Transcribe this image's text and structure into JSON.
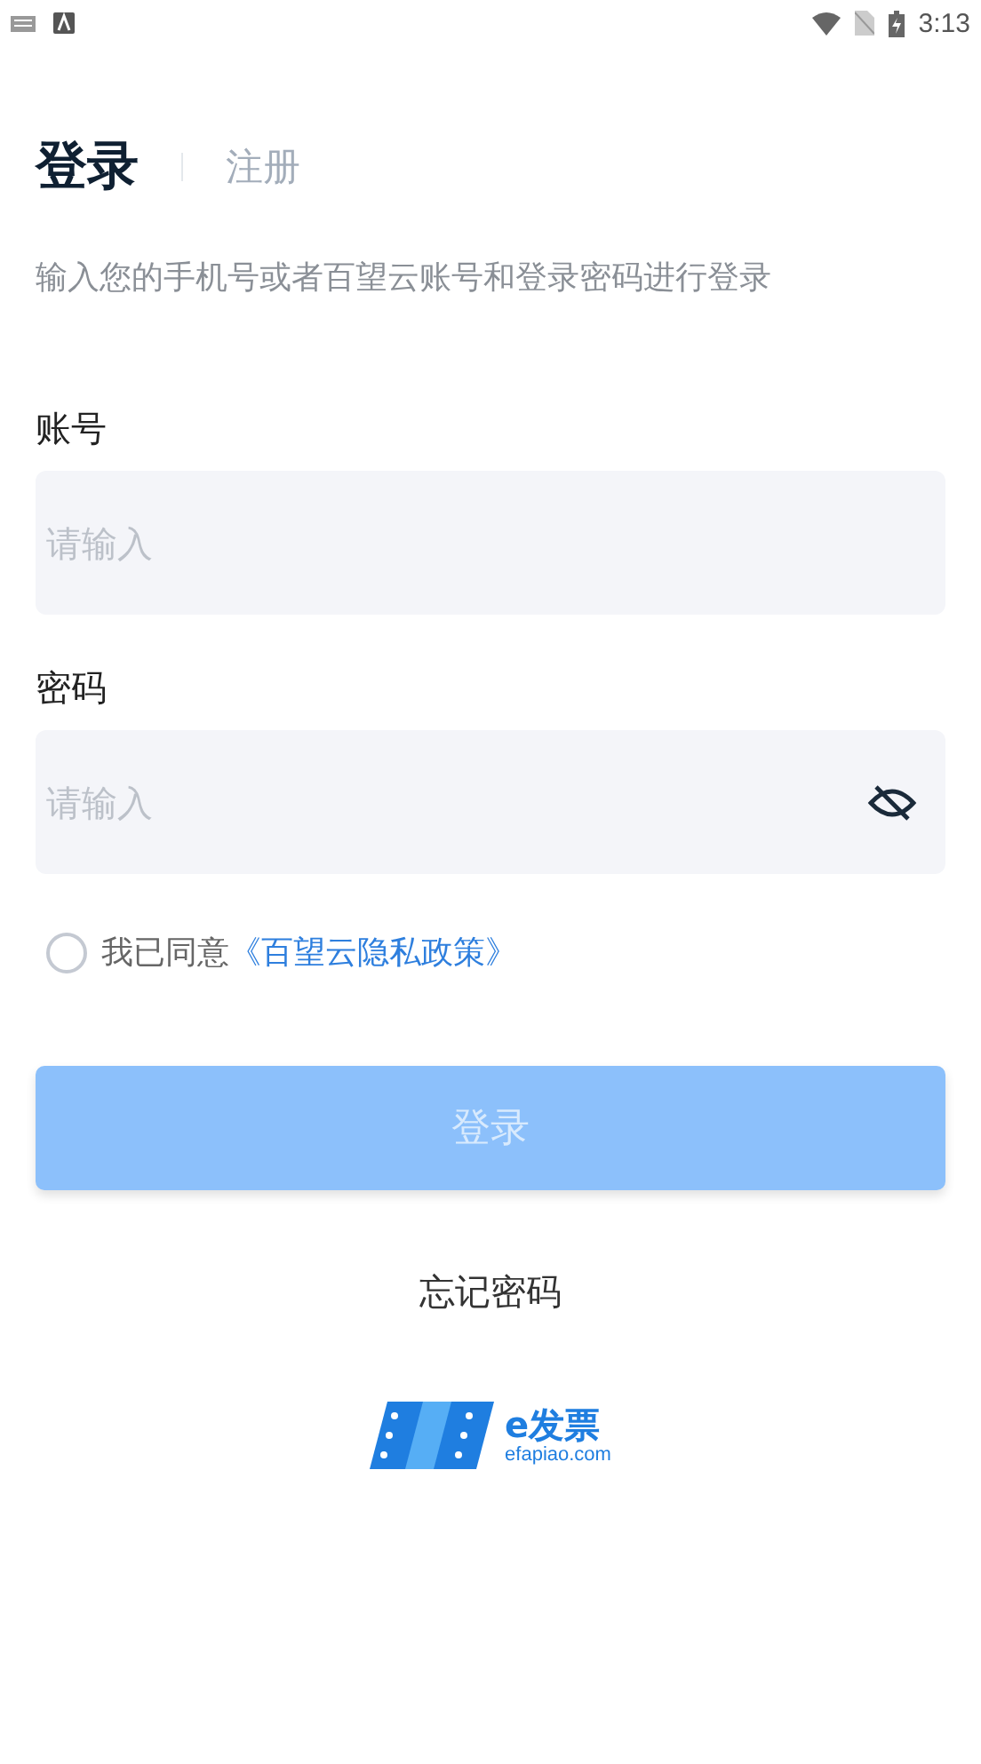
{
  "status_bar": {
    "time": "3:13"
  },
  "tabs": [
    {
      "label": "登录",
      "selected": true
    },
    {
      "label": "注册",
      "selected": false
    }
  ],
  "subtitle": "输入您的手机号或者百望云账号和登录密码进行登录",
  "fields": [
    {
      "label": "账号",
      "placeholder": "请输入",
      "kind": "text"
    },
    {
      "label": "密码",
      "placeholder": "请输入",
      "kind": "password"
    }
  ],
  "agreement": {
    "checked": false,
    "text": "我已同意",
    "link": "《百望云隐私政策》"
  },
  "login_button": {
    "label": "登录",
    "disabled": true
  },
  "forgot_link": "忘记密码",
  "logo": {
    "brand": "e发票",
    "domain": "efapiao.com"
  }
}
